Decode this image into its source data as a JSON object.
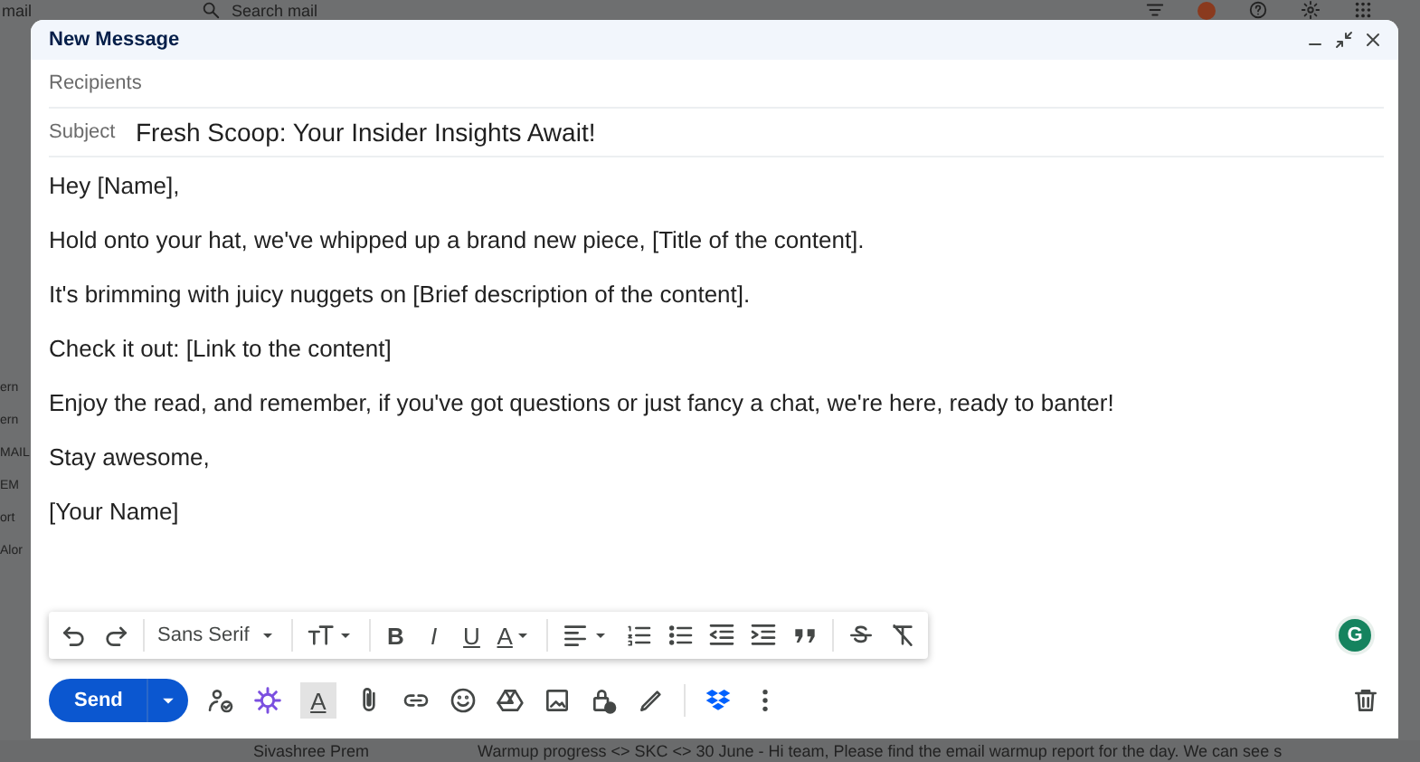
{
  "background": {
    "app_name": "mail",
    "search_placeholder": "Search mail",
    "side_labels": [
      "ern",
      "ern",
      "MAIL",
      "EM",
      "ort",
      "Alor"
    ],
    "message_row": {
      "sender": "Sivashree Prem",
      "snippet": "Warmup progress <> SKC <> 30 June - Hi team, Please find the email warmup report for the day. We can see s"
    }
  },
  "compose": {
    "title": "New Message",
    "recipients": {
      "placeholder": "Recipients"
    },
    "subject": {
      "label": "Subject",
      "value": "Fresh Scoop: Your Insider Insights Await!"
    },
    "body": [
      "Hey [Name],",
      "Hold onto your hat, we've whipped up a brand new piece, [Title of the content].",
      "It's brimming with juicy nuggets on [Brief description of the content].",
      "Check it out: [Link to the content]",
      "Enjoy the read, and remember, if you've got questions or just fancy a chat, we're here, ready to banter!",
      "Stay awesome,",
      "[Your Name]"
    ],
    "format_bar": {
      "font": "Sans Serif",
      "bold": "B",
      "italic": "I",
      "underline": "U",
      "text_color": "A"
    },
    "grammar_badge": "G",
    "actions": {
      "send": "Send",
      "formatting_toggle": {
        "label": "A",
        "selected": true
      }
    }
  }
}
